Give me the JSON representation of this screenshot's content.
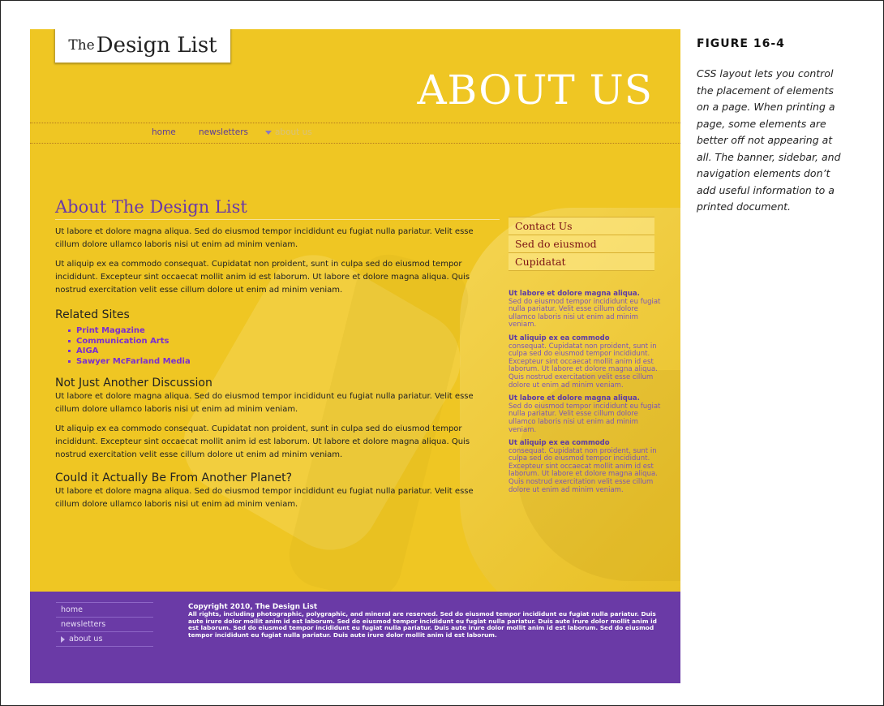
{
  "figure": {
    "label": "FIGURE 16-4",
    "caption": "CSS layout lets you control the placement of elements on a page. When printing a page, some elements are better off not appearing at all. The banner, sidebar, and navigation elements don’t add useful information to a printed document."
  },
  "site": {
    "logo_the": "The",
    "logo_name": "Design List",
    "banner_title": "ABOUT US",
    "nav": {
      "home": "home",
      "newsletters": "newsletters",
      "about": "about us"
    },
    "main": {
      "title": "About The Design List",
      "p1": "Ut labore et dolore magna aliqua. Sed do eiusmod tempor incididunt eu fugiat nulla pariatur. Velit esse cillum dolore ullamco laboris nisi ut enim ad minim veniam.",
      "p2": "Ut aliquip ex ea commodo consequat. Cupidatat non proident, sunt in culpa sed do eiusmod tempor incididunt. Excepteur sint occaecat mollit anim id est laborum. Ut labore et dolore magna aliqua. Quis nostrud exercitation velit esse cillum dolore ut enim ad minim veniam.",
      "related_heading": "Related Sites",
      "related_links": [
        "Print Magazine",
        "Communication Arts",
        "AIGA",
        "Sawyer McFarland Media"
      ],
      "h2_discussion": "Not Just Another Discussion",
      "p3": "Ut labore et dolore magna aliqua. Sed do eiusmod tempor incididunt eu fugiat nulla pariatur. Velit esse cillum dolore ullamco laboris nisi ut enim ad minim veniam.",
      "p4": "Ut aliquip ex ea commodo consequat. Cupidatat non proident, sunt in culpa sed do eiusmod tempor incididunt. Excepteur sint occaecat mollit anim id est laborum. Ut labore et dolore magna aliqua. Quis nostrud exercitation velit esse cillum dolore ut enim ad minim veniam.",
      "h2_planet": "Could it Actually Be From Another Planet?",
      "p5": "Ut labore et dolore magna aliqua. Sed do eiusmod tempor incididunt eu fugiat nulla pariatur. Velit esse cillum dolore ullamco laboris nisi ut enim ad minim veniam."
    },
    "sidebar_menu": [
      "Contact Us",
      "Sed do eiusmod",
      "Cupidatat"
    ],
    "sidebar_blocks": [
      {
        "title": "Ut labore et dolore magna aliqua.",
        "text": "Sed do eiusmod tempor incididunt eu fugiat nulla pariatur. Velit esse cillum dolore ullamco laboris nisi ut enim ad minim veniam."
      },
      {
        "title": "Ut aliquip ex ea commodo",
        "text": "consequat. Cupidatat non proident, sunt in culpa sed do eiusmod tempor incididunt. Excepteur sint occaecat mollit anim id est laborum. Ut labore et dolore magna aliqua. Quis nostrud exercitation velit esse cillum dolore ut enim ad minim veniam."
      },
      {
        "title": "Ut labore et dolore magna aliqua.",
        "text": "Sed do eiusmod tempor incididunt eu fugiat nulla pariatur. Velit esse cillum dolore ullamco laboris nisi ut enim ad minim veniam."
      },
      {
        "title": "Ut aliquip ex ea commodo",
        "text": "consequat. Cupidatat non proident, sunt in culpa sed do eiusmod tempor incididunt. Excepteur sint occaecat mollit anim id est laborum. Ut labore et dolore magna aliqua. Quis nostrud exercitation velit esse cillum dolore ut enim ad minim veniam."
      }
    ],
    "footer": {
      "nav": [
        "home",
        "newsletters",
        "about us"
      ],
      "copyright_title": "Copyright 2010, The Design List",
      "copyright_text": "All rights, including photographic, polygraphic, and mineral are reserved. Sed do eiusmod tempor incididunt eu fugiat nulla pariatur. Duis aute irure dolor mollit anim id est laborum. Sed do eiusmod tempor incididunt eu fugiat nulla pariatur. Duis aute irure dolor mollit anim id est laborum. Sed do eiusmod tempor incididunt eu fugiat nulla pariatur. Duis aute irure dolor mollit anim id est laborum. Sed do eiusmod tempor incididunt eu fugiat nulla pariatur. Duis aute irure dolor mollit anim id est laborum."
    },
    "colors": {
      "page_yellow": "#efc623",
      "accent_purple": "#6a3aa6",
      "link_purple": "#7a2fd0",
      "sidebar_link_red": "#7a0f12"
    }
  }
}
